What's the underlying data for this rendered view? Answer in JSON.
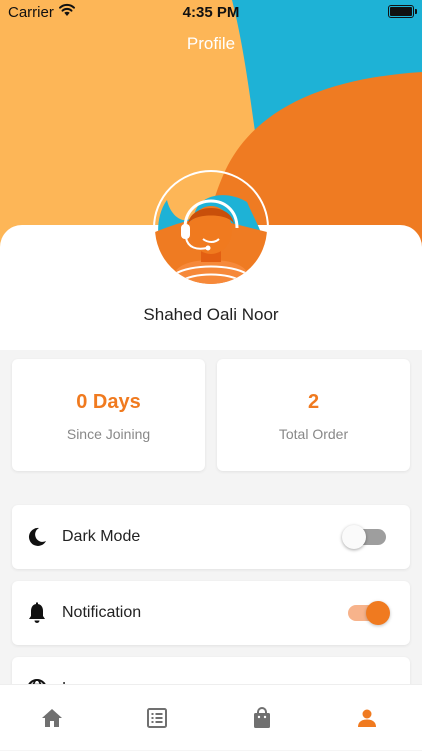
{
  "status_bar": {
    "carrier": "Carrier",
    "time": "4:35 PM"
  },
  "header": {
    "title": "Profile"
  },
  "user": {
    "name": "Shahed Oali Noor",
    "avatar_icon": "support-agent-avatar"
  },
  "stats": [
    {
      "value": "0 Days",
      "label": "Since Joining"
    },
    {
      "value": "2",
      "label": "Total Order"
    }
  ],
  "settings": [
    {
      "icon": "moon-icon",
      "label": "Dark Mode",
      "enabled": false
    },
    {
      "icon": "bell-icon",
      "label": "Notification",
      "enabled": true
    },
    {
      "icon": "globe-icon",
      "label": "L"
    }
  ],
  "tabs": [
    {
      "name": "home",
      "icon": "home-icon",
      "active": false
    },
    {
      "name": "orders",
      "icon": "list-icon",
      "active": false
    },
    {
      "name": "cart",
      "icon": "bag-icon",
      "active": false
    },
    {
      "name": "profile",
      "icon": "person-icon",
      "active": true
    }
  ],
  "colors": {
    "accent": "#f07a1f",
    "hero_yellow": "#fdb657",
    "hero_blue": "#1eb2d6",
    "hero_orange": "#ef7b22",
    "inactive_icon": "#707070"
  }
}
